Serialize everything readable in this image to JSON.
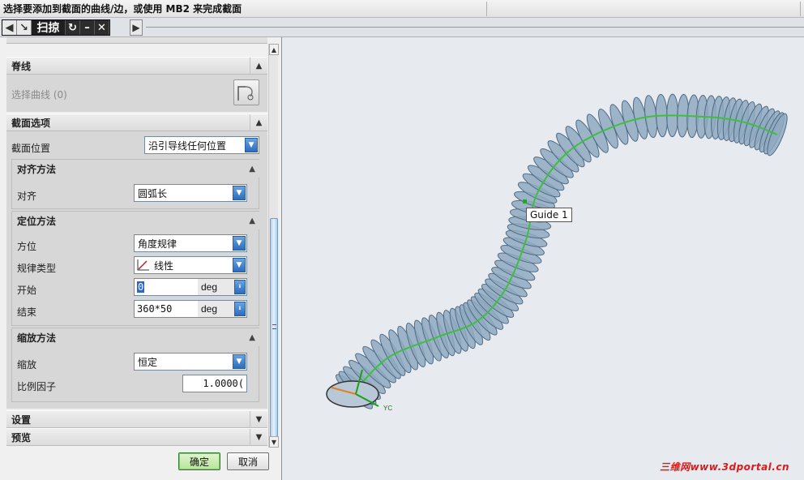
{
  "status_bar": {
    "prompt": "选择要添加到截面的曲线/边，或使用 MB2 来完成截面"
  },
  "toolbar": {
    "title": "扫掠",
    "back_icon": "chevron-left-icon",
    "select_icon": "arrow-cursor-icon",
    "undo_icon": "undo-icon",
    "minimize_icon": "minus-icon",
    "close_icon": "close-icon",
    "forward_icon": "chevron-right-icon"
  },
  "dialog": {
    "spine": {
      "header": "脊线",
      "select_curve": "选择曲线 (0)"
    },
    "section_options": {
      "header": "截面选项",
      "position_label": "截面位置",
      "position_value": "沿引导线任何位置",
      "alignment": {
        "header": "对齐方法",
        "align_label": "对齐",
        "align_value": "圆弧长"
      },
      "orientation": {
        "header": "定位方法",
        "orientation_label": "方位",
        "orientation_value": "角度规律",
        "law_type_label": "规律类型",
        "law_type_value": "线性",
        "start_label": "开始",
        "start_value": "0",
        "start_unit": "deg",
        "end_label": "结束",
        "end_value": "360*50",
        "end_unit": "deg"
      },
      "scaling": {
        "header": "缩放方法",
        "scale_label": "缩放",
        "scale_value": "恒定",
        "factor_label": "比例因子",
        "factor_value": "1.0000("
      }
    },
    "settings_header": "设置",
    "preview_header": "预览",
    "ok_label": "确定",
    "cancel_label": "取消"
  },
  "viewport": {
    "guide_label": "Guide 1",
    "axis_label": "YC",
    "watermark": "三维网www.3dportal.cn",
    "colors": {
      "coil": "#8fa9bf",
      "guide_curve": "#3fbf3f",
      "watermark": "#e01818"
    }
  }
}
